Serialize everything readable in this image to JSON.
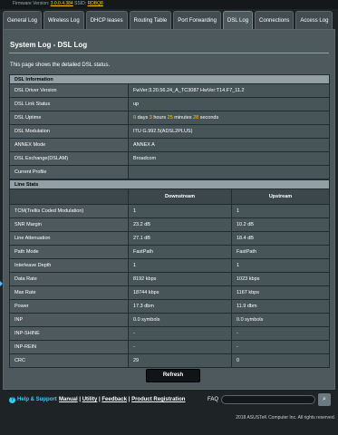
{
  "topbar": {
    "text": "Firmware Version: ",
    "fw": "3.0.0.4.384",
    "ssid_label": " SSID: ",
    "ssid": "RDBQ8"
  },
  "tabs": [
    "General Log",
    "Wireless Log",
    "DHCP leases",
    "Routing Table",
    "Port Forwarding",
    "DSL Log",
    "Connections",
    "Access Log"
  ],
  "active_tab": "DSL Log",
  "page": {
    "title": "System Log - DSL Log",
    "description": "This page shows the detailed DSL status."
  },
  "dsl_info": {
    "header": "DSL Information",
    "rows": [
      {
        "label": "DSL Driver Version",
        "value": "FwVer:3.20.56.24_A_TC3087 HwVer:T14.F7_11.2"
      },
      {
        "label": "DSL Link Status",
        "value": "up"
      },
      {
        "label": "DSL Uptime",
        "value": ""
      },
      {
        "label": "DSL Modulation",
        "value": "ITU G.992.5(ADSL2PLUS)"
      },
      {
        "label": "ANNEX Mode",
        "value": "ANNEX A"
      },
      {
        "label": "DSL Exchange(DSLAM)",
        "value": "Broadcom"
      },
      {
        "label": "Current Profile",
        "value": ""
      }
    ],
    "uptime": {
      "days": "0",
      "days_label": "days",
      "hours": "3",
      "hours_label": "hours",
      "minutes": "25",
      "minutes_label": "minutes",
      "seconds": "28",
      "seconds_label": "seconds"
    }
  },
  "line_stats": {
    "header": "Line Stats",
    "col_downstream": "Downstream",
    "col_upstream": "Upstream",
    "rows": [
      {
        "label": "TCM(Trellis Coded Modulation)",
        "down": "1",
        "up": "1"
      },
      {
        "label": "SNR Margin",
        "down": "23.2 dB",
        "up": "10.2 dB"
      },
      {
        "label": "Line Attenuation",
        "down": "27.1 dB",
        "up": "18.4 dB"
      },
      {
        "label": "Path Mode",
        "down": "FastPath",
        "up": "FastPath"
      },
      {
        "label": "Interleave Depth",
        "down": "1",
        "up": "1"
      },
      {
        "label": "Data Rate",
        "down": "8192 kbps",
        "up": "1023 kbps"
      },
      {
        "label": "Max Rate",
        "down": "18744 kbps",
        "up": "1167 kbps"
      },
      {
        "label": "Power",
        "down": "17.3 dbm",
        "up": "11.9 dbm"
      },
      {
        "label": "INP",
        "down": "0.0 symbols",
        "up": "0.0 symbols"
      },
      {
        "label": "INP-SHINE",
        "down": "-",
        "up": "-"
      },
      {
        "label": "INP-REIN",
        "down": "-",
        "up": "-"
      },
      {
        "label": "CRC",
        "down": "29",
        "up": "0"
      }
    ]
  },
  "refresh_label": "Refresh",
  "footer": {
    "help": "Help & Support",
    "manual": "Manual",
    "utility": "Utility",
    "feedback": "Feedback",
    "product_registration": "Product Registration",
    "faq": "FAQ",
    "copyright": "2018 ASUSTeK Computer Inc. All rights reserved."
  }
}
